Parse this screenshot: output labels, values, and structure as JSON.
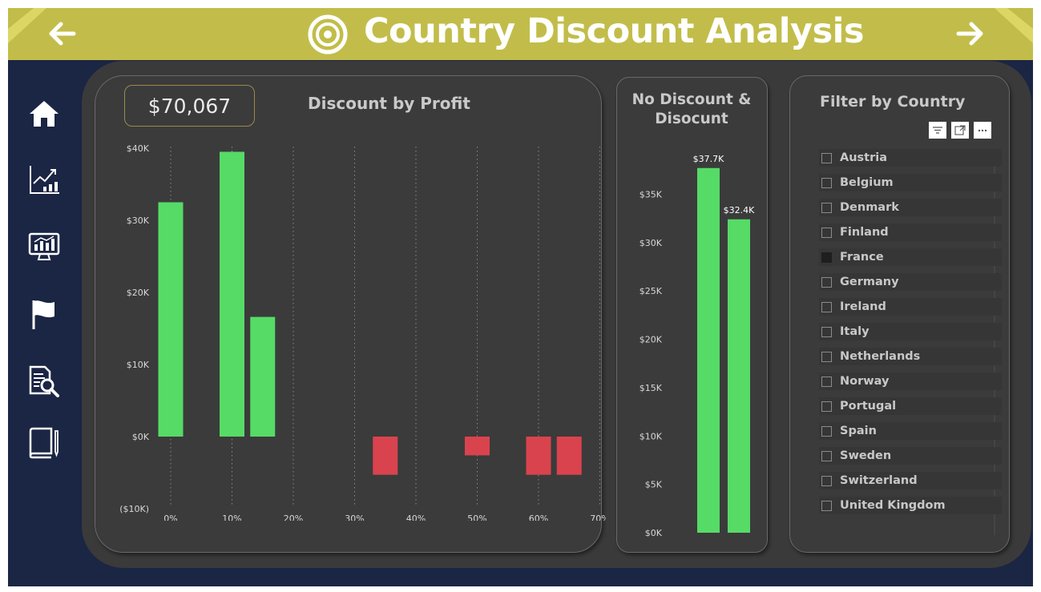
{
  "header": {
    "title": "Country Discount Analysis",
    "back_icon": "arrow-left-icon",
    "forward_icon": "arrow-right-icon",
    "logo_icon": "target-icon",
    "bg_color": "#c2bd4a"
  },
  "sidebar": {
    "items": [
      {
        "icon": "home-icon"
      },
      {
        "icon": "trend-chart-icon"
      },
      {
        "icon": "monitor-chart-icon"
      },
      {
        "icon": "flag-icon"
      },
      {
        "icon": "document-search-icon"
      },
      {
        "icon": "book-icon"
      }
    ]
  },
  "kpi": {
    "value": "$70,067"
  },
  "colors": {
    "positive": "#56db67",
    "negative": "#d9434e",
    "background": "#1b2544",
    "panel": "#3a3a3a"
  },
  "discount_chart": {
    "title": "Discount by Profit",
    "chart_data": {
      "type": "bar",
      "xlabel": "",
      "ylabel": "",
      "x_ticks": [
        "0%",
        "10%",
        "20%",
        "30%",
        "40%",
        "50%",
        "60%",
        "70%"
      ],
      "y_ticks": [
        "$40K",
        "$30K",
        "$20K",
        "$10K",
        "$0K",
        "($10K)"
      ],
      "xlim": [
        0,
        70
      ],
      "ylim": [
        -10000,
        40000
      ],
      "bars": [
        {
          "x": 0,
          "value": 32500
        },
        {
          "x": 10,
          "value": 39500
        },
        {
          "x": 15,
          "value": 16600
        },
        {
          "x": 35,
          "value": -5300
        },
        {
          "x": 50,
          "value": -2600
        },
        {
          "x": 60,
          "value": -5300
        },
        {
          "x": 65,
          "value": -5300
        }
      ]
    }
  },
  "nodiscount_chart": {
    "title_line1": "No Discount &",
    "title_line2": "Disocunt",
    "chart_data": {
      "type": "bar",
      "y_ticks": [
        "$35K",
        "$30K",
        "$25K",
        "$20K",
        "$15K",
        "$10K",
        "$5K",
        "$0K"
      ],
      "ylim": [
        0,
        40000
      ],
      "values": [
        37700,
        32400
      ],
      "data_labels": [
        "$37.7K",
        "$32.4K"
      ]
    }
  },
  "filter": {
    "title": "Filter by Country",
    "tool_icons": [
      "filter-icon",
      "focus-mode-icon",
      "more-options-icon"
    ],
    "countries": [
      {
        "label": "Austria",
        "checked": false
      },
      {
        "label": "Belgium",
        "checked": false
      },
      {
        "label": "Denmark",
        "checked": false
      },
      {
        "label": "Finland",
        "checked": false
      },
      {
        "label": "France",
        "checked": true
      },
      {
        "label": "Germany",
        "checked": false
      },
      {
        "label": "Ireland",
        "checked": false
      },
      {
        "label": "Italy",
        "checked": false
      },
      {
        "label": "Netherlands",
        "checked": false
      },
      {
        "label": "Norway",
        "checked": false
      },
      {
        "label": "Portugal",
        "checked": false
      },
      {
        "label": "Spain",
        "checked": false
      },
      {
        "label": "Sweden",
        "checked": false
      },
      {
        "label": "Switzerland",
        "checked": false
      },
      {
        "label": "United Kingdom",
        "checked": false
      }
    ]
  }
}
